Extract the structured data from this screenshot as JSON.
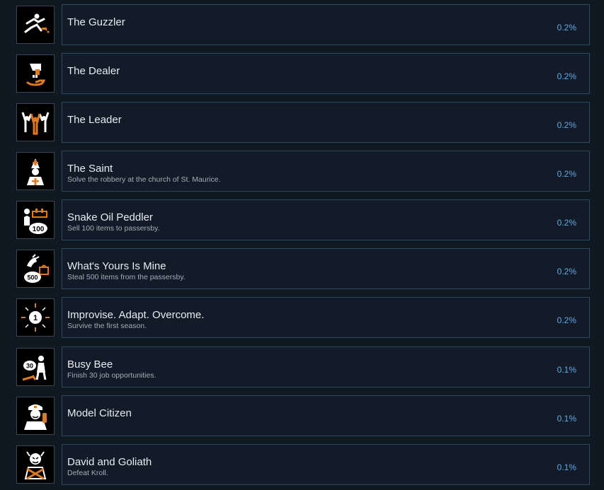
{
  "achievements": [
    {
      "title": "The Guzzler",
      "description": "",
      "percent": "0.2%",
      "icon": "guzzler-icon"
    },
    {
      "title": "The Dealer",
      "description": "",
      "percent": "0.2%",
      "icon": "dealer-icon"
    },
    {
      "title": "The Leader",
      "description": "",
      "percent": "0.2%",
      "icon": "leader-icon"
    },
    {
      "title": "The Saint",
      "description": "Solve the robbery at the church of St. Maurice.",
      "percent": "0.2%",
      "icon": "saint-icon"
    },
    {
      "title": "Snake Oil Peddler",
      "description": "Sell 100 items to passersby.",
      "percent": "0.2%",
      "icon": "snake-oil-peddler-icon",
      "badge": "100"
    },
    {
      "title": "What's Yours Is Mine",
      "description": "Steal 500 items from the passersby.",
      "percent": "0.2%",
      "icon": "whats-yours-is-mine-icon",
      "badge": "500"
    },
    {
      "title": "Improvise. Adapt. Overcome.",
      "description": "Survive the first season.",
      "percent": "0.2%",
      "icon": "improvise-adapt-overcome-icon",
      "badge": "1"
    },
    {
      "title": "Busy Bee",
      "description": "Finish 30 job opportunities.",
      "percent": "0.1%",
      "icon": "busy-bee-icon",
      "badge": "30"
    },
    {
      "title": "Model Citizen",
      "description": "",
      "percent": "0.1%",
      "icon": "model-citizen-icon"
    },
    {
      "title": "David and Goliath",
      "description": "Defeat Kroll.",
      "percent": "0.1%",
      "icon": "david-and-goliath-icon"
    }
  ],
  "colors": {
    "background": "#101822",
    "card": "#121b27",
    "card_border": "#2a4a5e",
    "title": "#e6ecf2",
    "description": "#a3adb8",
    "percent": "#5fa9e6",
    "icon_accent": "#e07a1f"
  }
}
